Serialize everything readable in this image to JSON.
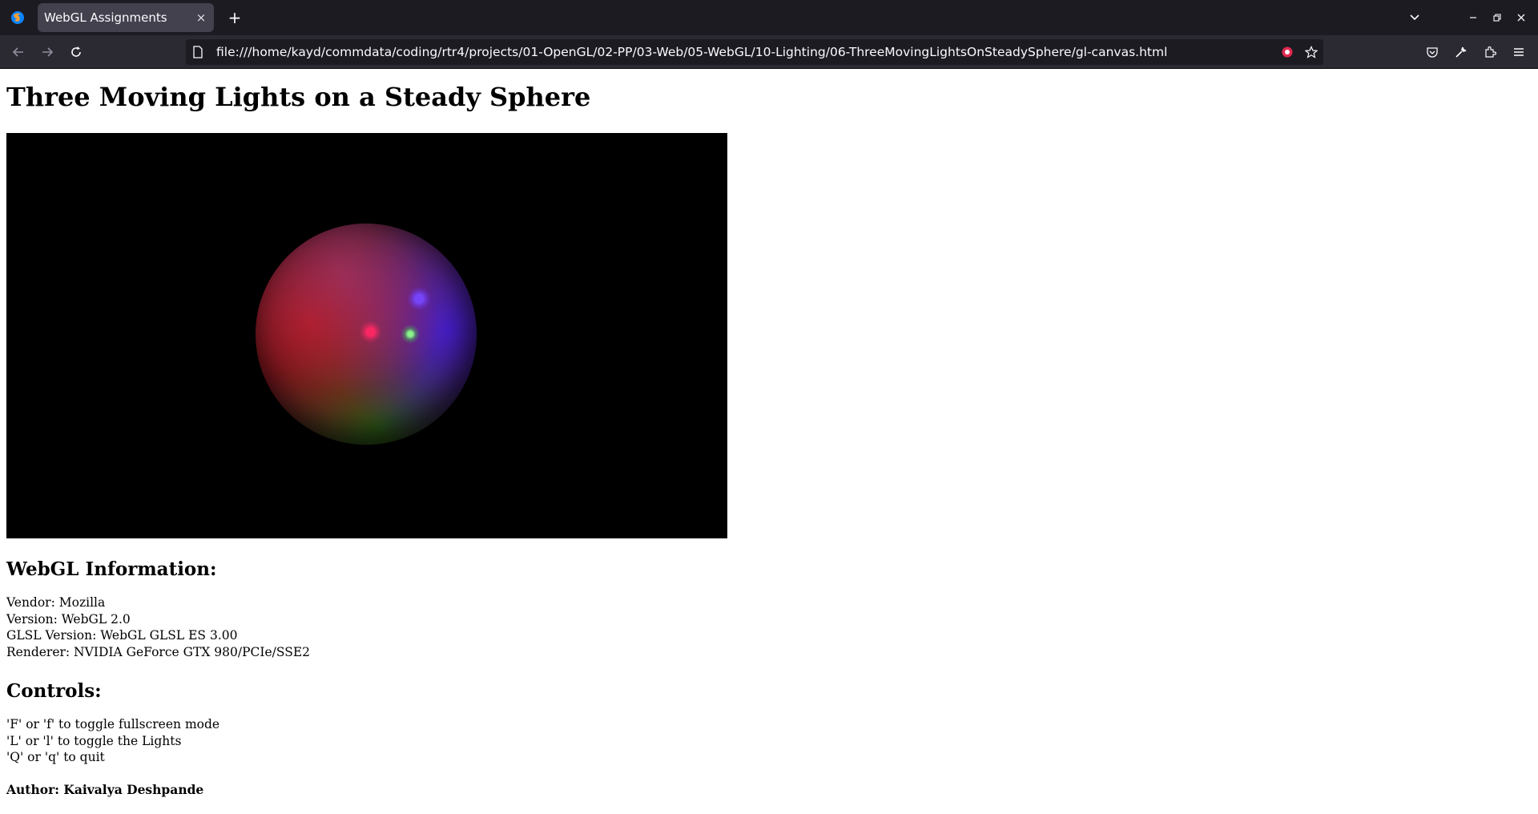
{
  "browser": {
    "tab_title": "WebGL Assignments",
    "tab_close": "×",
    "new_tab": "+",
    "url": "file:///home/kayd/commdata/coding/rtr4/projects/01-OpenGL/02-PP/03-Web/05-WebGL/10-Lighting/06-ThreeMovingLightsOnSteadySphere/gl-canvas.html",
    "icons": [
      "firefox-logo",
      "chevron-down-icon",
      "minimize-icon",
      "restore-icon",
      "close-icon",
      "back-icon",
      "forward-icon",
      "reload-icon",
      "page-icon",
      "shield-icon",
      "bookmark-star-icon",
      "pocket-icon",
      "wrench-icon",
      "extensions-icon",
      "menu-icon"
    ]
  },
  "page": {
    "title": "Three Moving Lights on a Steady Sphere",
    "info_heading": "WebGL Information:",
    "info_lines": [
      "Vendor: Mozilla",
      "Version: WebGL 2.0",
      "GLSL Version: WebGL GLSL ES 3.00",
      "Renderer: NVIDIA GeForce GTX 980/PCIe/SSE2"
    ],
    "controls_heading": "Controls:",
    "controls_lines": [
      "'F' or 'f' to toggle fullscreen mode",
      "'L' or 'l' to toggle the Lights",
      "'Q' or 'q' to quit"
    ],
    "author": "Author: Kaivalya Deshpande"
  },
  "colors": {
    "tabbar_bg": "#1c1b22",
    "navbar_bg": "#2b2a33",
    "canvas_bg": "#000000",
    "light_red": "#ff2864",
    "light_green": "#8cff8c",
    "light_blue": "#7846ff"
  }
}
